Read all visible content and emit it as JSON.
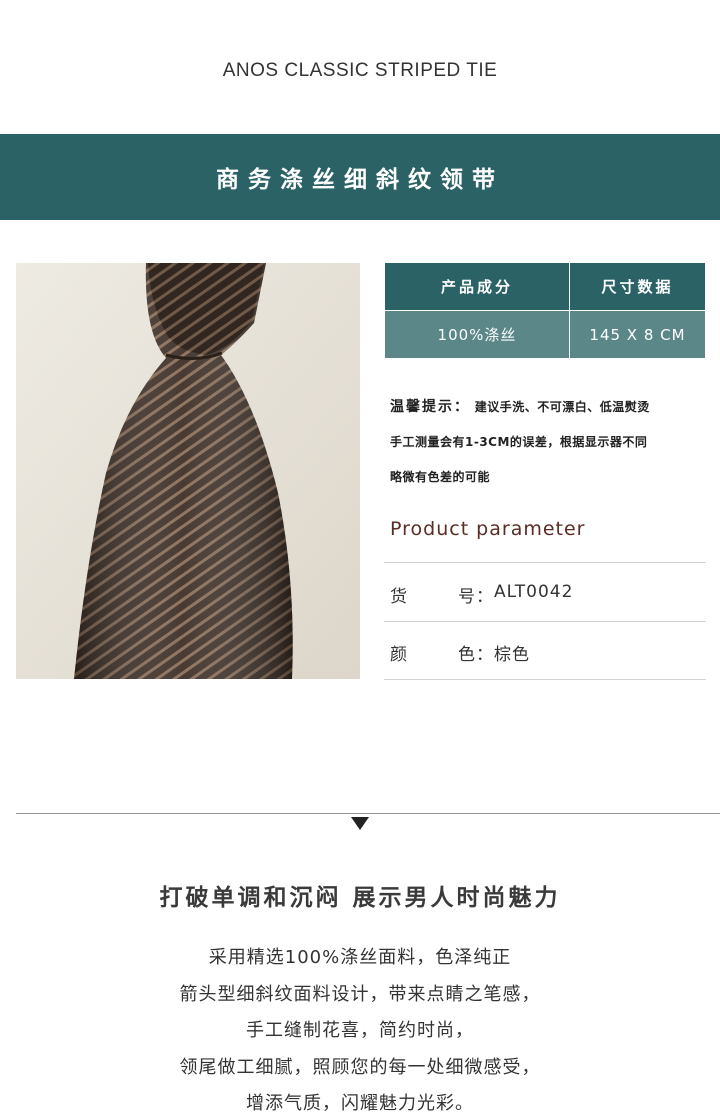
{
  "header": {
    "brand_title": "ANOS CLASSIC STRIPED TIE",
    "banner_title": "商务涤丝细斜纹领带"
  },
  "colors": {
    "banner": "#2b6266",
    "table_value_bg": "#5b8788",
    "param_heading": "#5a2c24",
    "tie_brown": "#4a3a2f"
  },
  "spec_table": {
    "headers": [
      "产品成分",
      "尺寸数据"
    ],
    "values": [
      "100%涤丝",
      "145 X 8  CM"
    ]
  },
  "tips": {
    "label": "温馨提示：",
    "line1": "建议手洗、不可漂白、低温熨烫",
    "line2": "手工测量会有1-3CM的误差，根据显示器不同",
    "line3": "略微有色差的可能"
  },
  "params": {
    "heading": "Product parameter",
    "items": [
      {
        "k1": "货",
        "k2": "号：",
        "value": "ALT0042"
      },
      {
        "k1": "颜",
        "k2": "色：",
        "value": "棕色"
      }
    ]
  },
  "slogan": "打破单调和沉闷 展示男人时尚魅力",
  "description": [
    "采用精选100%涤丝面料，色泽纯正",
    "箭头型细斜纹面料设计，带来点睛之笔感，",
    "手工缝制花喜，简约时尚，",
    "领尾做工细腻，照顾您的每一处细微感受，",
    "增添气质，闪耀魅力光彩。"
  ],
  "images": {
    "product_photo": "brown-striped-tie-photo"
  }
}
